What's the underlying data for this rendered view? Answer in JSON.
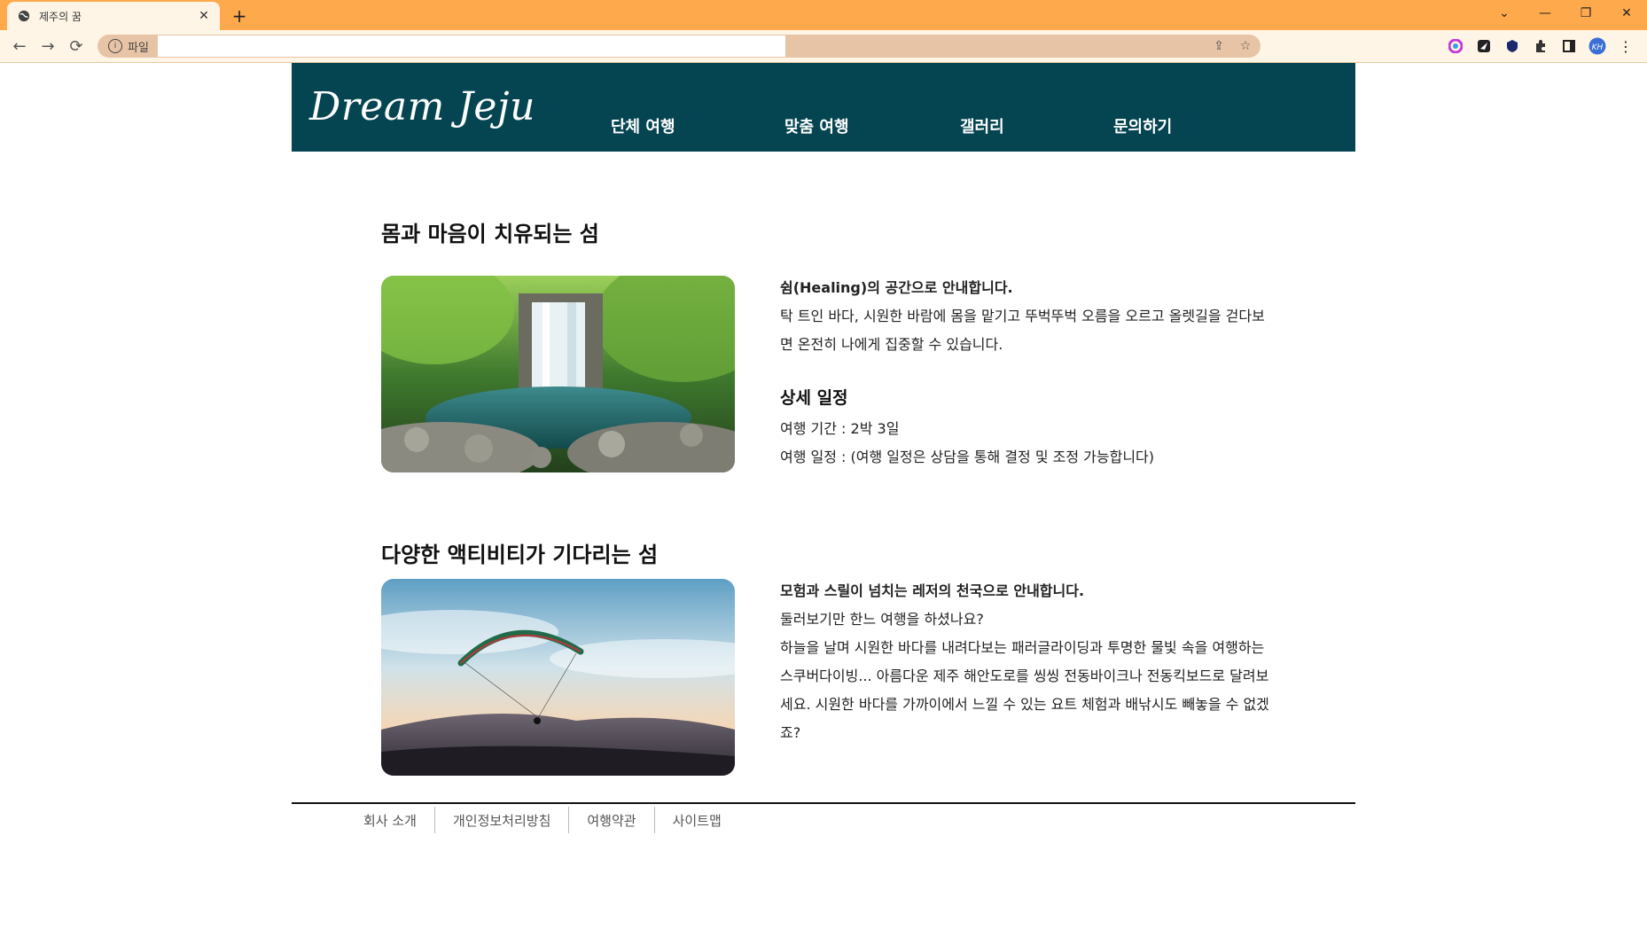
{
  "browser": {
    "tab_title": "제주의 꿈",
    "close_symbol": "✕",
    "new_tab_symbol": "+",
    "address_badge": "파일",
    "address_value": "",
    "back_symbol": "←",
    "forward_symbol": "→",
    "reload_symbol": "⟳",
    "window": {
      "dropdown": "⌄",
      "minimize": "—",
      "restore": "❐",
      "close": "✕"
    },
    "ext_avatar": "KH"
  },
  "header": {
    "logo": "Dream Jeju",
    "nav": [
      "단체 여행",
      "맞춤 여행",
      "갤러리",
      "문의하기"
    ],
    "bg_color": "#054552"
  },
  "section1": {
    "title": "몸과 마음이 치유되는 섬",
    "lead": "쉼(Healing)의 공간으로 안내합니다.",
    "body": "탁 트인 바다, 시원한 바람에 몸을 맡기고 뚜벅뚜벅 오름을 오르고 올렛길을 걷다보면 온전히 나에게 집중할 수 있습니다.",
    "detail_title": "상세 일정",
    "detail_lines": [
      "여행 기간 : 2박 3일",
      "여행 일정 : (여행 일정은 상담을 통해 결정 및 조정 가능합니다)"
    ],
    "image": "waterfall"
  },
  "section2": {
    "title": "다양한 액티비티가 기다리는 섬",
    "lead": "모험과 스릴이 넘치는 레저의 천국으로 안내합니다.",
    "body1": "둘러보기만 한느 여행을 하셨나요?",
    "body2": "하늘을 날며 시원한 바다를 내려다보는 패러글라이딩과 투명한 물빛 속을 여행하는 스쿠버다이빙... 아름다운 제주 해안도로를 씽씽 전동바이크나 전동킥보드로 달려보세요. 시원한 바다를 가까이에서 느낄 수 있는 요트 체험과 배낚시도 빼놓을 수 없겠죠?",
    "image": "paraglider"
  },
  "footer": {
    "links": [
      "회사 소개",
      "개인정보처리방침",
      "여행약관",
      "사이트맵"
    ]
  }
}
